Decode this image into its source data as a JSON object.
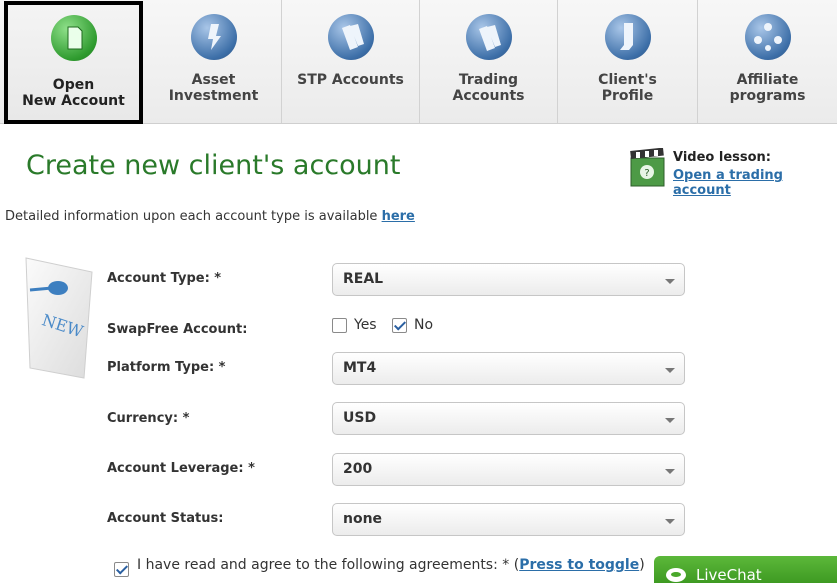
{
  "tabs": [
    {
      "label_line1": "Open",
      "label_line2": "New Account",
      "icon": "open-account-icon",
      "active": true
    },
    {
      "label_line1": "Asset",
      "label_line2": "Investment",
      "icon": "asset-investment-icon",
      "active": false
    },
    {
      "label_line1": "STP Accounts",
      "label_line2": "",
      "icon": "stp-accounts-icon",
      "active": false
    },
    {
      "label_line1": "Trading",
      "label_line2": "Accounts",
      "icon": "trading-accounts-icon",
      "active": false
    },
    {
      "label_line1": "Client's",
      "label_line2": "Profile",
      "icon": "client-profile-icon",
      "active": false
    },
    {
      "label_line1": "Affiliate programs",
      "label_line2": "",
      "icon": "affiliate-programs-icon",
      "active": false
    }
  ],
  "page": {
    "title": "Create new client's account",
    "video_title": "Video lesson:",
    "video_link": "Open a trading account",
    "info_text": "Detailed information upon each account type is available",
    "info_link": "here"
  },
  "form": {
    "account_type": {
      "label": "Account Type: *",
      "value": "REAL"
    },
    "swapfree": {
      "label": "SwapFree Account:",
      "yes_label": "Yes",
      "no_label": "No",
      "yes_checked": false,
      "no_checked": true
    },
    "platform_type": {
      "label": "Platform Type: *",
      "value": "MT4"
    },
    "currency": {
      "label": "Currency: *",
      "value": "USD"
    },
    "leverage": {
      "label": "Account Leverage: *",
      "value": "200"
    },
    "status": {
      "label": "Account Status:",
      "value": "none"
    },
    "agree_text": "I have read and agree to the following agreements: * (",
    "agree_link": "Press to toggle",
    "agree_end": ")",
    "agree_checked": true
  },
  "note_badge": "NEW",
  "livechat": {
    "label": "LiveChat"
  },
  "colors": {
    "title_green": "#2a7a2a",
    "link_blue": "#2b6ea8",
    "livechat_green": "#4aa82b"
  }
}
